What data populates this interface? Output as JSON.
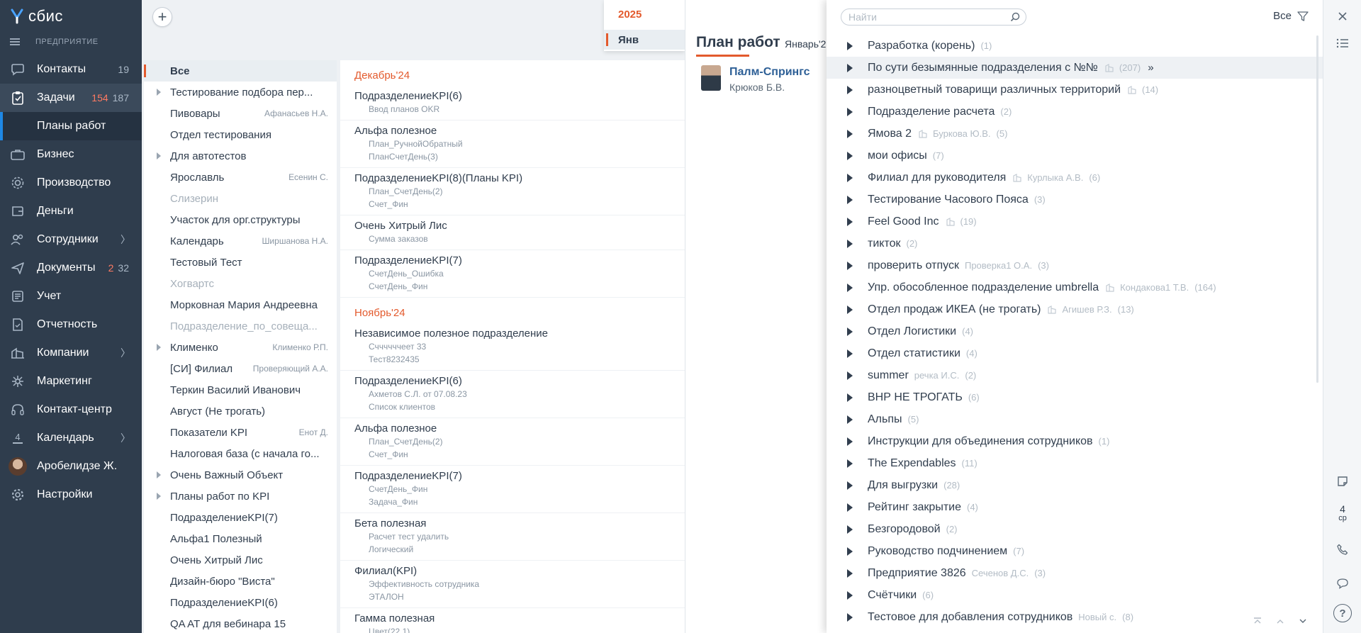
{
  "app": {
    "logo_text": "сбис",
    "org": "ПРЕДПРИЯТИЕ"
  },
  "nav": {
    "items": [
      {
        "label": "Контакты",
        "count": "19",
        "icon": "contacts-icon"
      },
      {
        "label": "Задачи",
        "count_red": "154",
        "count": "187",
        "icon": "tasks-icon"
      },
      {
        "label": "Бизнес",
        "icon": "business-icon"
      },
      {
        "label": "Производство",
        "icon": "production-icon"
      },
      {
        "label": "Деньги",
        "icon": "money-icon"
      },
      {
        "label": "Сотрудники",
        "icon": "employees-icon"
      },
      {
        "label": "Документы",
        "count_red": "2",
        "count": "32",
        "icon": "documents-icon"
      },
      {
        "label": "Учет",
        "icon": "accounting-icon"
      },
      {
        "label": "Отчетность",
        "icon": "reporting-icon"
      },
      {
        "label": "Компании",
        "icon": "companies-icon"
      },
      {
        "label": "Маркетинг",
        "icon": "marketing-icon"
      },
      {
        "label": "Контакт-центр",
        "icon": "contact-center-icon"
      },
      {
        "label": "Календарь",
        "day": "4",
        "icon": "calendar-icon"
      },
      {
        "label": "Аробелидзе Ж.",
        "icon": "avatar"
      },
      {
        "label": "Настройки",
        "icon": "settings-icon"
      }
    ],
    "sub_active": "Планы работ"
  },
  "year_panel": {
    "year": "2025",
    "month": "Янв"
  },
  "folders": [
    {
      "name": "Все",
      "selected": true
    },
    {
      "name": "Тестирование подбора пер...",
      "expandable": true
    },
    {
      "name": "Пивовары",
      "owner": "Афанасьев Н.А."
    },
    {
      "name": "Отдел тестирования"
    },
    {
      "name": "Для автотестов",
      "expandable": true
    },
    {
      "name": "Ярославль",
      "owner": "Есенин С."
    },
    {
      "name": "Слизерин",
      "dim": true
    },
    {
      "name": "Участок для орг.структуры"
    },
    {
      "name": "Календарь",
      "owner": "Ширшанова Н.А."
    },
    {
      "name": "Тестовый Тест"
    },
    {
      "name": "Хогвартс",
      "dim": true
    },
    {
      "name": "Морковная Мария Андреевна"
    },
    {
      "name": "Подразделение_по_совеща...",
      "dim": true
    },
    {
      "name": "Клименко",
      "owner": "Клименко Р.П.",
      "expandable": true
    },
    {
      "name": "[СИ] Филиал",
      "owner": "Проверяющий А.А."
    },
    {
      "name": "Теркин Василий Иванович"
    },
    {
      "name": "Август (Не трогать)"
    },
    {
      "name": "Показатели KPI",
      "owner": "Енот Д."
    },
    {
      "name": "Налоговая база (с начала го..."
    },
    {
      "name": "Очень Важный Объект",
      "expandable": true
    },
    {
      "name": "Планы работ по KPI",
      "expandable": true
    },
    {
      "name": "ПодразделениеKPI(7)"
    },
    {
      "name": "Альфа1 Полезный"
    },
    {
      "name": "Очень Хитрый Лис"
    },
    {
      "name": "Дизайн-бюро \"Виста\""
    },
    {
      "name": "ПодразделениеKPI(6)"
    },
    {
      "name": "QA AT для вебинара 15"
    }
  ],
  "plans": [
    {
      "month": "Декабрь'24",
      "items": [
        {
          "title": "ПодразделениеKPI(6)",
          "sub": [
            "Ввод планов OKR"
          ]
        },
        {
          "title": "Альфа полезное",
          "sub": [
            "План_РучнойОбратный",
            "ПланСчетДень(3)"
          ]
        },
        {
          "title": "ПодразделениеKPI(8)(Планы KPI)",
          "sub": [
            "План_СчетДень(2)",
            "Счет_Фин"
          ]
        },
        {
          "title": "Очень Хитрый Лис",
          "sub": [
            "Сумма заказов"
          ]
        },
        {
          "title": "ПодразделениеKPI(7)",
          "sub": [
            "СчетДень_Ошибка",
            "СчетДень_Фин"
          ]
        }
      ]
    },
    {
      "month": "Ноябрь'24",
      "items": [
        {
          "title": "Независимое полезное подразделение",
          "sub": [
            "Сччччччеет 33",
            "Тест8232435"
          ]
        },
        {
          "title": "ПодразделениеKPI(6)",
          "sub": [
            "Ахметов С.Л. от 07.08.23",
            "Список клиентов"
          ]
        },
        {
          "title": "Альфа полезное",
          "sub": [
            "План_СчетДень(2)",
            "Счет_Фин"
          ]
        },
        {
          "title": "ПодразделениеKPI(7)",
          "sub": [
            "СчетДень_Фин",
            "Задача_Фин"
          ]
        },
        {
          "title": "Бета полезная",
          "sub": [
            "Расчет тест удалить",
            "Логический"
          ]
        },
        {
          "title": "Филиал(KPI)",
          "sub": [
            "Эффективность сотрудника",
            "ЭТАЛОН"
          ]
        },
        {
          "title": "Гамма полезная",
          "sub": [
            "Цвет(22.1)"
          ]
        }
      ]
    }
  ],
  "work_plan": {
    "title": "План работ",
    "period": "Январь'2",
    "employee_name": "Палм-Спрингс",
    "employee_sub": "Крюков Б.В."
  },
  "popup": {
    "search_placeholder": "Найти",
    "filter_label": "Все",
    "departments": [
      {
        "name": "Разработка (корень)",
        "count": "(1)"
      },
      {
        "name": "По сути безымянные подразделения с №№",
        "building": true,
        "count": "(207)",
        "more": true,
        "highlight": true
      },
      {
        "name": "разноцветный товарищи различных территорий",
        "building": true,
        "count": "(14)"
      },
      {
        "name": "Подразделение расчета",
        "count": "(2)"
      },
      {
        "name": "Ямова 2",
        "building": true,
        "head": "Буркова Ю.В.",
        "count": "(5)"
      },
      {
        "name": "мои офисы",
        "count": "(7)"
      },
      {
        "name": "Филиал для руководителя",
        "building": true,
        "head": "Курлыка А.В.",
        "count": "(6)"
      },
      {
        "name": "Тестирование Часового Пояса",
        "count": "(3)"
      },
      {
        "name": "Feel Good Inc",
        "building": true,
        "count": "(19)"
      },
      {
        "name": "тикток",
        "count": "(2)"
      },
      {
        "name": "проверить отпуск",
        "head": "Проверка1 О.А.",
        "count": "(3)"
      },
      {
        "name": "Упр. обособленное подразделение umbrella",
        "building": true,
        "head": "Кондакова1 Т.В.",
        "count": "(164)"
      },
      {
        "name": "Отдел продаж ИКЕА (не трогать)",
        "building": true,
        "head": "Агишев Р.З.",
        "count": "(13)"
      },
      {
        "name": "Отдел Логистики",
        "count": "(4)"
      },
      {
        "name": "Отдел статистики",
        "count": "(4)"
      },
      {
        "name": "summer",
        "head": "речка И.С.",
        "count": "(2)"
      },
      {
        "name": "ВНР НЕ ТРОГАТЬ",
        "count": "(6)"
      },
      {
        "name": "Альпы",
        "count": "(5)"
      },
      {
        "name": "Инструкции для объединения сотрудников",
        "count": "(1)"
      },
      {
        "name": "The Expendables",
        "count": "(11)"
      },
      {
        "name": "Для выгрузки",
        "count": "(28)"
      },
      {
        "name": "Рейтинг закрытие",
        "count": "(4)"
      },
      {
        "name": "Безгородовой",
        "count": "(2)"
      },
      {
        "name": "Руководство подчинением",
        "count": "(7)"
      },
      {
        "name": "Предприятие 3826",
        "head": "Сеченов Д.С.",
        "count": "(3)"
      },
      {
        "name": "Счётчики",
        "count": "(6)"
      },
      {
        "name": "Тестовое для добавления сотрудников",
        "head": "Новый с.",
        "count": "(8)"
      }
    ]
  },
  "rail": {
    "day": "4",
    "weekday": "ср"
  },
  "colors": {
    "accent": "#e35a2d",
    "nav_bg": "#2f3d4d",
    "link": "#2d5f96",
    "active_marker": "#1e88e5"
  }
}
